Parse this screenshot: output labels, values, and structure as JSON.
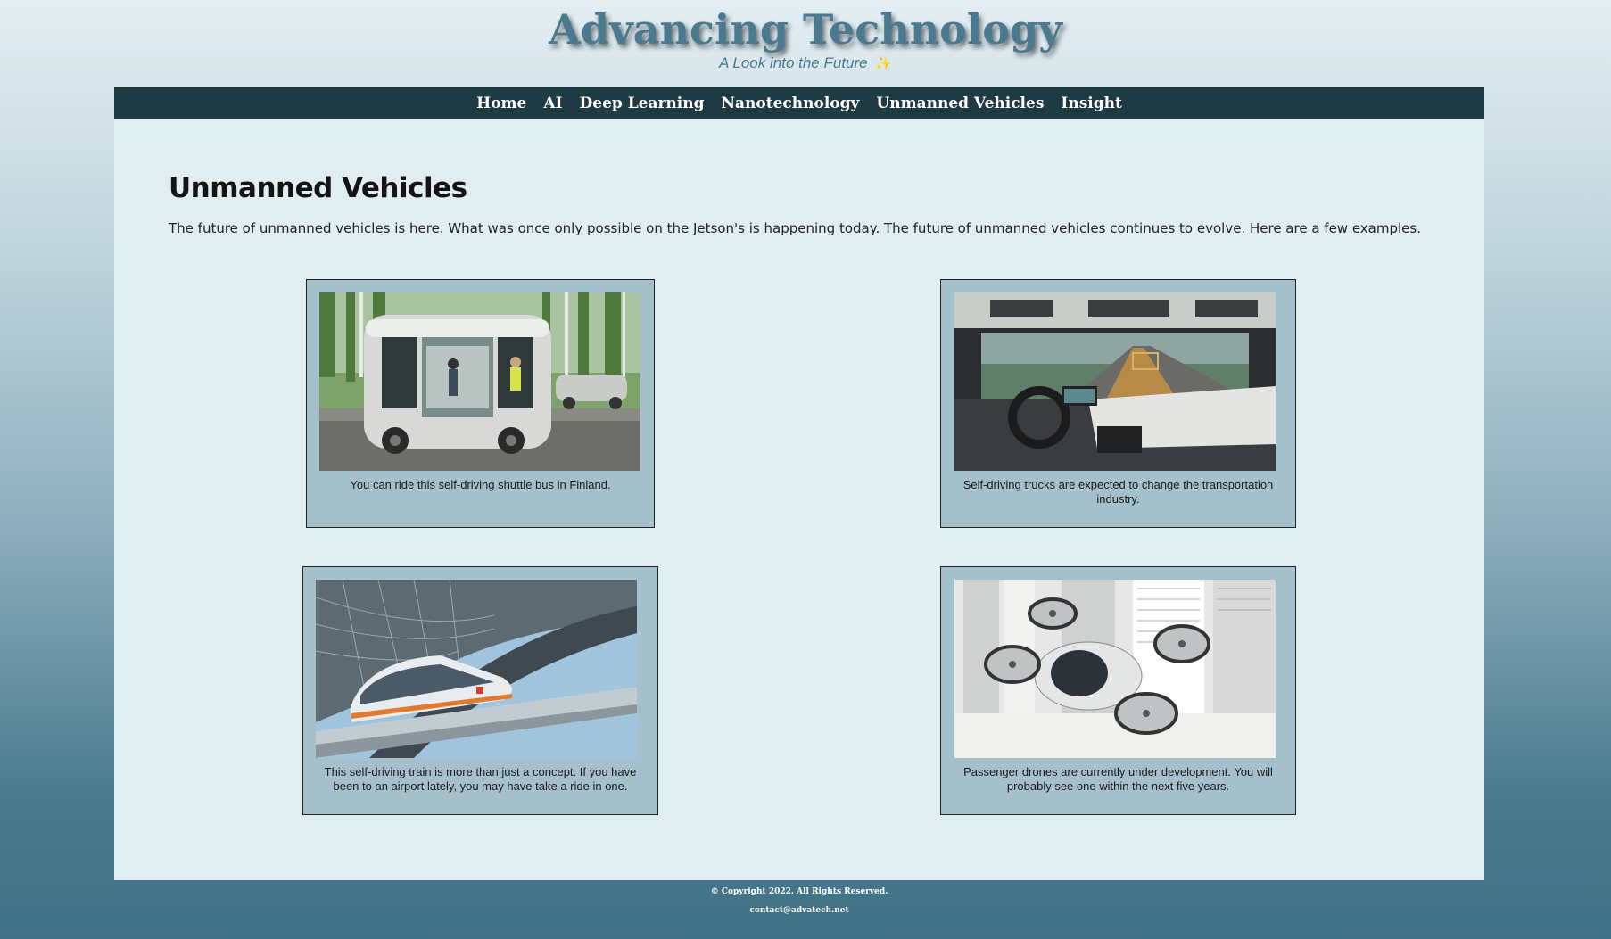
{
  "header": {
    "title": "Advancing Technology",
    "tagline": "A Look into the Future",
    "tagline_icon": "dizzy-star-icon"
  },
  "nav": {
    "items": [
      {
        "label": "Home"
      },
      {
        "label": "AI"
      },
      {
        "label": "Deep Learning"
      },
      {
        "label": "Nanotechnology"
      },
      {
        "label": "Unmanned Vehicles"
      },
      {
        "label": "Insight"
      }
    ]
  },
  "main": {
    "heading": "Unmanned Vehicles",
    "intro": "The future of unmanned vehicles is here. What was once only possible on the Jetson's is happening today. The future of unmanned vehicles continues to evolve. Here are a few examples.",
    "cards": [
      {
        "image": "shuttle-bus-image",
        "caption": "You can ride this self-driving shuttle bus in Finland."
      },
      {
        "image": "truck-cabin-image",
        "caption": "Self-driving trucks are expected to change the transportation industry."
      },
      {
        "image": "monorail-train-image",
        "caption": "This self-driving train is more than just a concept. If you have been to an airport lately, you may have take a ride in one."
      },
      {
        "image": "passenger-drone-image",
        "caption": "Passenger drones are currently under development. You will probably see one within the next five years."
      }
    ]
  },
  "footer": {
    "copyright": "© Copyright 2022. All Rights Reserved.",
    "contact": "contact@advatech.net"
  },
  "colors": {
    "nav_bg": "#1e3a43",
    "content_bg": "#e0edf1",
    "card_bg": "#a3c0cb",
    "title": "#4a7a8f"
  }
}
